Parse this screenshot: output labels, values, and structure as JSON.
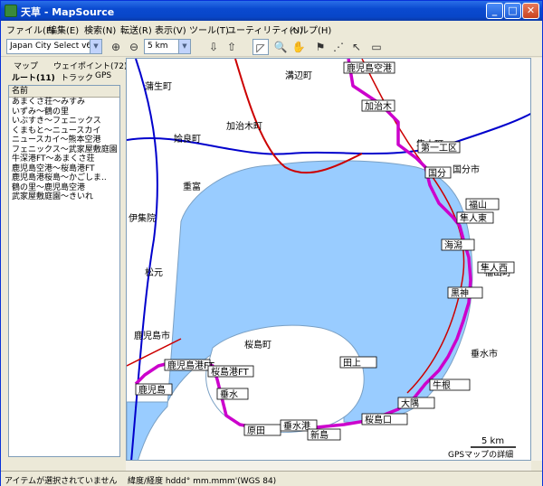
{
  "window": {
    "title": "天草 - MapSource"
  },
  "menu": [
    "ファイル(F)",
    "編集(E)",
    "検索(N)",
    "転送(R)",
    "表示(V)",
    "ツール(T)",
    "ユーティリティ(U)",
    "ヘルプ(H)"
  ],
  "toolbar": {
    "map_product": "Japan City Select v6",
    "zoom_scale": "5 km"
  },
  "tabs": {
    "map": "マップ",
    "waypoints": "ウェイポイント(72)",
    "routes": "ルート(11)",
    "tracks": "トラック",
    "gps": "GPS"
  },
  "list": {
    "header": "名前",
    "items": [
      "あまくさ荘〜みすみ",
      "いずみ〜鶴の里",
      "いぶすき〜フェニックス",
      "くまもと〜ニュースカイ",
      "ニュースカイ〜熊本空港",
      "フェニックス〜武家屋敷庭園",
      "牛深港FT〜あまくさ荘",
      "鹿児島空港〜桜島港FT",
      "鹿児島港桜島〜かごしま..",
      "鶴の里〜鹿児島空港",
      "武家屋敷庭園〜きいれ"
    ]
  },
  "map": {
    "scale_label": "5 km",
    "copyright": "GPSマップの詳細",
    "boxed_labels": [
      "鹿児島空港",
      "加治木",
      "第一工区",
      "国分",
      "福山",
      "隼人東",
      "隼人西",
      "鹿児島港FT",
      "桜島港FT",
      "垂水",
      "原田",
      "鹿児島",
      "垂水港",
      "桜島口",
      "牛根",
      "黒神",
      "新島",
      "海潟",
      "田上",
      "大隅"
    ],
    "labels": [
      "蒲生町",
      "加治木町",
      "隼人町",
      "溝辺町",
      "姶良町",
      "国分市",
      "福山町",
      "桜島町",
      "鹿児島市",
      "垂水市",
      "重富",
      "松元",
      "伊集院"
    ]
  },
  "status": {
    "selection": "アイテムが選択されていません",
    "coord_format": "緯度/経度 hddd° mm.mmm'(WGS 84)"
  }
}
